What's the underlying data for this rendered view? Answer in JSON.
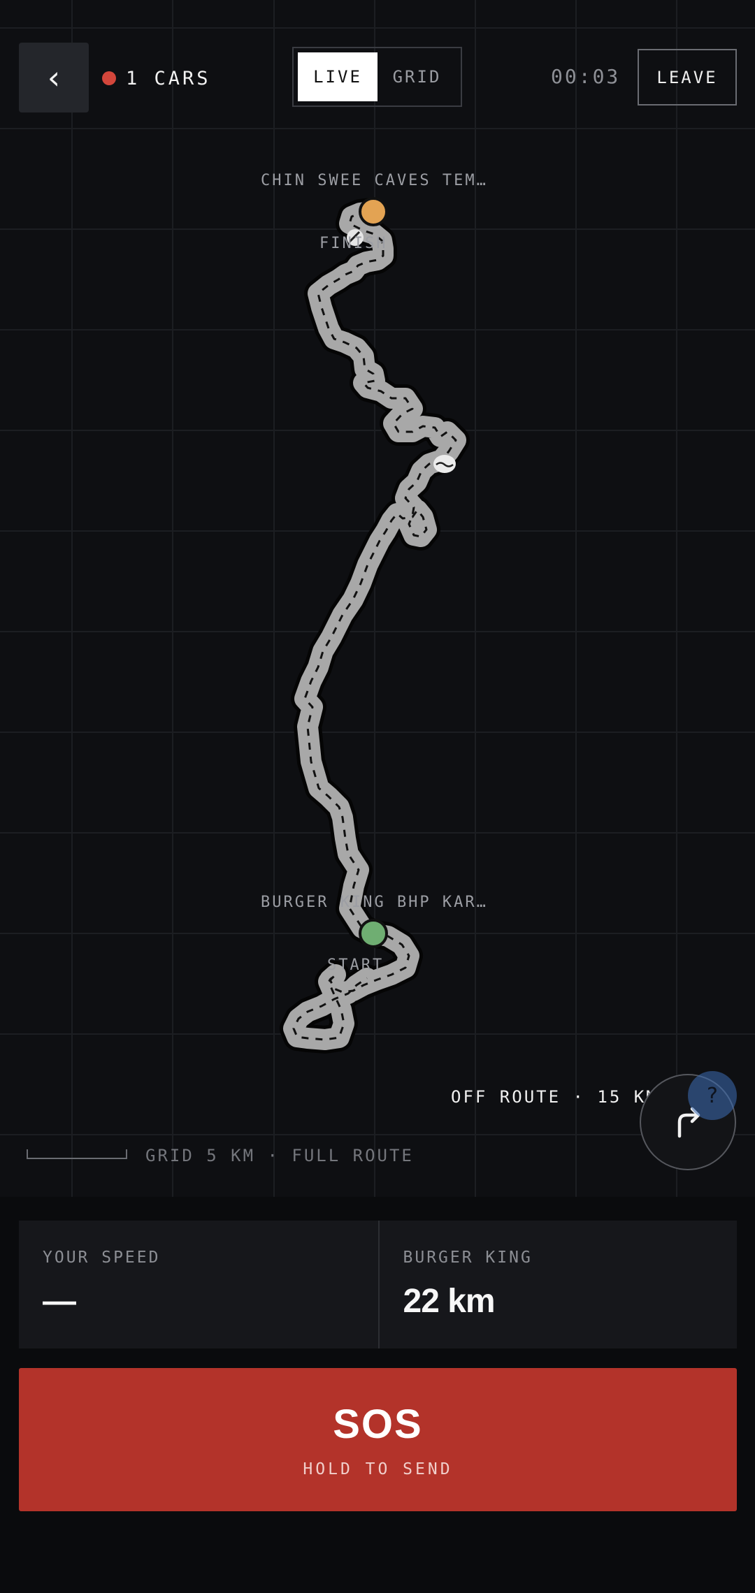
{
  "header": {
    "back_glyph": "‹",
    "cars_label": "1 CARS",
    "cars_dot_color": "#d3463b",
    "tabs": [
      {
        "label": "LIVE",
        "active": true
      },
      {
        "label": "GRID",
        "active": false
      }
    ],
    "timer": "00:03",
    "leave_label": "LEAVE"
  },
  "map": {
    "finish_name": "CHIN SWEE CAVES TEM…",
    "finish_label": "FINISH",
    "finish_color": "#e3a353",
    "start_name": "BURGER KING BHP KAR…",
    "start_label": "START",
    "start_color": "#6fae72",
    "off_route": "OFF ROUTE · 15 KM",
    "user_marker_glyph": "?",
    "scale_label": "GRID 5 KM · FULL ROUTE"
  },
  "stats": {
    "speed_label": "YOUR SPEED",
    "speed_value": "—",
    "dest_label": "BURGER KING",
    "dest_value": "22 km"
  },
  "sos": {
    "label": "SOS",
    "hint": "HOLD TO SEND",
    "color": "#b3332a"
  }
}
